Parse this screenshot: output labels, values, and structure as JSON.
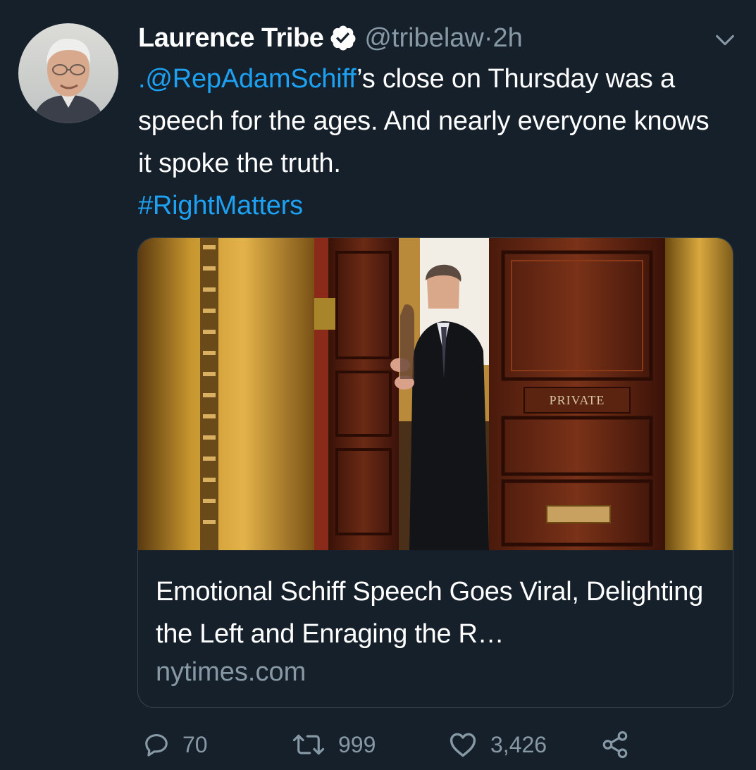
{
  "tweet": {
    "author_name": "Laurence Tribe",
    "handle": "@tribelaw",
    "separator": " · ",
    "time": "2h",
    "text_mention": ".@RepAdamSchiff",
    "text_body": "’s close on Thursday was a speech for the ages. And nearly everyone knows it spoke the truth.",
    "hashtag": "#RightMatters"
  },
  "card": {
    "title": "Emotional Schiff Speech Goes Viral, Delighting the Left and Enraging the R…",
    "domain": "nytimes.com",
    "sign_text": "PRIVATE"
  },
  "actions": {
    "replies": "70",
    "retweets": "999",
    "likes": "3,426"
  },
  "icons": {
    "verified": "verified-badge-icon",
    "caret": "chevron-down-icon",
    "reply": "reply-icon",
    "retweet": "retweet-icon",
    "like": "heart-icon",
    "share": "share-icon"
  },
  "colors": {
    "background": "#15202b",
    "link": "#1da1f2",
    "secondary_text": "#8899a6",
    "border": "#38444d"
  }
}
